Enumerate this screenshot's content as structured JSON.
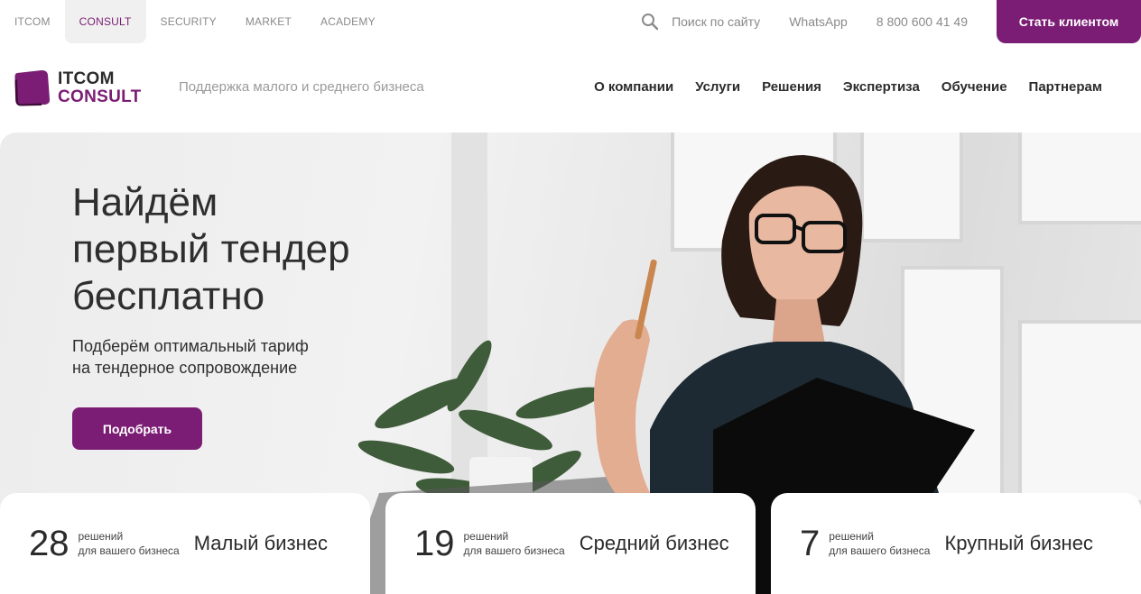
{
  "top_tabs": [
    {
      "label": "ITCOM",
      "active": false
    },
    {
      "label": "CONSULT",
      "active": true
    },
    {
      "label": "SECURITY",
      "active": false
    },
    {
      "label": "MARKET",
      "active": false
    },
    {
      "label": "ACADEMY",
      "active": false
    }
  ],
  "search": {
    "label": "Поиск по сайту",
    "icon": "search-icon"
  },
  "whatsapp": "WhatsApp",
  "phone": "8 800 600 41 49",
  "cta_top": "Стать клиентом",
  "logo": {
    "line1": "ITCOM",
    "line2": "CONSULT"
  },
  "tagline": "Поддержка малого и среднего бизнеса",
  "nav": [
    "О компании",
    "Услуги",
    "Решения",
    "Экспертиза",
    "Обучение",
    "Партнерам"
  ],
  "hero": {
    "title_lines": [
      "Найдём",
      "первый тендер",
      "бесплатно"
    ],
    "subtitle_lines": [
      "Подберём оптимальный тариф",
      "на тендерное сопровождение"
    ],
    "button": "Подобрать"
  },
  "cards": [
    {
      "count": "28",
      "small1": "решений",
      "small2": "для вашего бизнеса",
      "segment": "Малый бизнес"
    },
    {
      "count": "19",
      "small1": "решений",
      "small2": "для вашего бизнеса",
      "segment": "Средний бизнес"
    },
    {
      "count": "7",
      "small1": "решений",
      "small2": "для вашего бизнеса",
      "segment": "Крупный бизнес"
    }
  ],
  "colors": {
    "brand": "#7b1d74",
    "text": "#2b2b2b",
    "muted": "#8a8a8a"
  }
}
